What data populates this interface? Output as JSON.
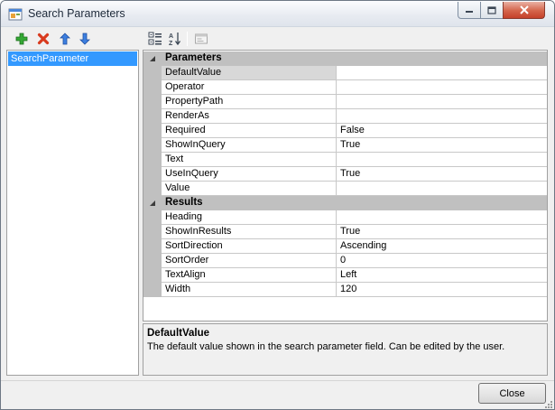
{
  "window": {
    "title": "Search Parameters"
  },
  "list": {
    "items": [
      "SearchParameter"
    ]
  },
  "grid": {
    "categories": [
      {
        "name": "Parameters",
        "properties": [
          {
            "name": "DefaultValue",
            "value": "",
            "selected": true
          },
          {
            "name": "Operator",
            "value": ""
          },
          {
            "name": "PropertyPath",
            "value": ""
          },
          {
            "name": "RenderAs",
            "value": ""
          },
          {
            "name": "Required",
            "value": "False"
          },
          {
            "name": "ShowInQuery",
            "value": "True"
          },
          {
            "name": "Text",
            "value": ""
          },
          {
            "name": "UseInQuery",
            "value": "True"
          },
          {
            "name": "Value",
            "value": ""
          }
        ]
      },
      {
        "name": "Results",
        "properties": [
          {
            "name": "Heading",
            "value": ""
          },
          {
            "name": "ShowInResults",
            "value": "True"
          },
          {
            "name": "SortDirection",
            "value": "Ascending"
          },
          {
            "name": "SortOrder",
            "value": "0"
          },
          {
            "name": "TextAlign",
            "value": "Left"
          },
          {
            "name": "Width",
            "value": "120"
          }
        ]
      }
    ]
  },
  "help": {
    "title": "DefaultValue",
    "description": "The default value shown in the search parameter field. Can be edited by the user."
  },
  "buttons": {
    "close": "Close"
  },
  "colors": {
    "selection": "#3399ff",
    "category": "#c0c0c0",
    "add": "#2e9e2e",
    "remove": "#d83a1e",
    "arrow": "#2f6fd6"
  }
}
